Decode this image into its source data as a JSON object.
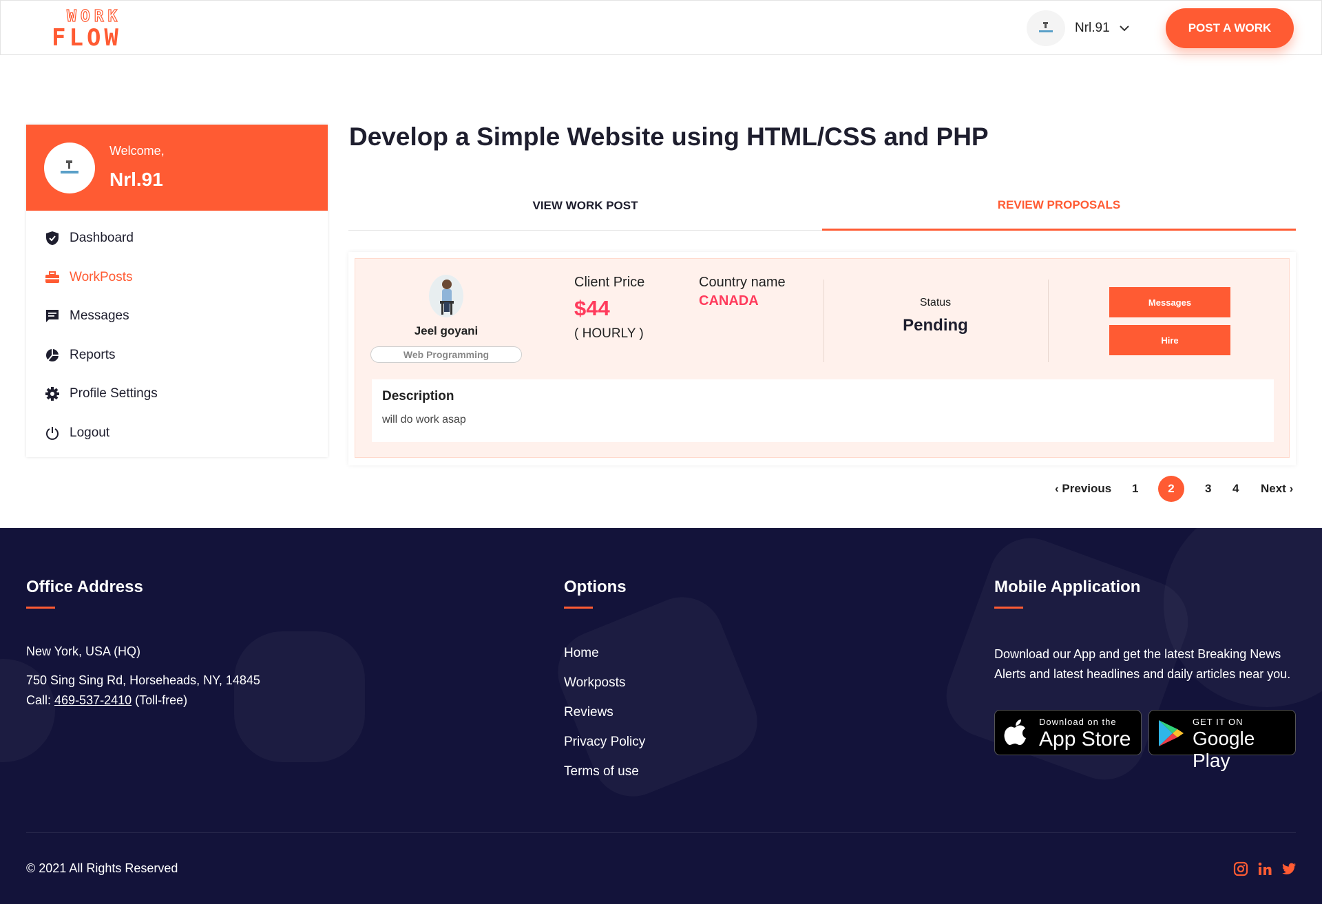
{
  "brand": {
    "logo_top": "WORK",
    "logo_bottom": "FLOW",
    "accent": "#ff5b33",
    "footer_bg": "#13133a",
    "highlight": "#ff3b5c"
  },
  "header": {
    "username": "Nrl.91",
    "post_button": "POST A WORK"
  },
  "sidebar": {
    "welcome": "Welcome,",
    "name": "Nrl.91",
    "items": [
      {
        "label": "Dashboard",
        "icon": "shield-icon"
      },
      {
        "label": "WorkPosts",
        "icon": "briefcase-icon"
      },
      {
        "label": "Messages",
        "icon": "message-icon"
      },
      {
        "label": "Reports",
        "icon": "pie-chart-icon"
      },
      {
        "label": "Profile Settings",
        "icon": "gear-icon"
      },
      {
        "label": "Logout",
        "icon": "power-icon"
      }
    ]
  },
  "main": {
    "title": "Develop a Simple Website using HTML/CSS and PHP",
    "tabs": [
      {
        "label": "VIEW WORK POST"
      },
      {
        "label": "REVIEW PROPOSALS"
      }
    ]
  },
  "proposal": {
    "freelancer_name": "Jeel goyani",
    "skill": "Web Programming",
    "client_price_label": "Client Price",
    "price": "$44",
    "price_unit": "( HOURLY )",
    "country_label": "Country name",
    "country": "CANADA",
    "status_label": "Status",
    "status": "Pending",
    "messages_button": "Messages",
    "hire_button": "Hire",
    "description_label": "Description",
    "description": "will do work asap"
  },
  "pagination": {
    "previous": "Previous",
    "pages": [
      "1",
      "2",
      "3",
      "4"
    ],
    "current": "2",
    "next": "Next"
  },
  "footer": {
    "office": {
      "title": "Office Address",
      "hq": "New York, USA (HQ)",
      "address": "750 Sing Sing Rd, Horseheads, NY, 14845",
      "call_label": "Call:",
      "phone": "469-537-2410",
      "toll": "(Toll-free)"
    },
    "options": {
      "title": "Options",
      "links": [
        "Home",
        "Workposts",
        "Reviews",
        "Privacy Policy",
        "Terms of use"
      ]
    },
    "mobile": {
      "title": "Mobile Application",
      "text": "Download our App and get the latest Breaking News Alerts and latest headlines and daily articles near you.",
      "appstore_small": "Download on the",
      "appstore_big": "App Store",
      "googleplay_small": "GET IT ON",
      "googleplay_big": "Google Play"
    },
    "copyright": "© 2021 All Rights Reserved",
    "social": [
      "instagram-icon",
      "linkedin-icon",
      "twitter-icon"
    ]
  }
}
